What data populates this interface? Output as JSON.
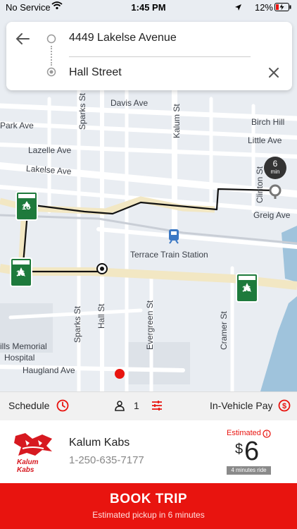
{
  "status_bar": {
    "carrier": "No Service",
    "time": "1:45 PM",
    "battery": "12%"
  },
  "route": {
    "origin": "4449 Lakelse Avenue",
    "destination": "Hall Street"
  },
  "map": {
    "streets": {
      "sparks_top": "Sparks St",
      "davis": "Davis Ave",
      "kalum": "Kalum St",
      "birch_hill": "Birch Hill",
      "park": "Park Ave",
      "little": "Little Ave",
      "lazelle": "Lazelle Ave",
      "lakelse": "Lakelse Ave",
      "clinton": "Clinton St",
      "greig": "Greig Ave",
      "sparks_bottom": "Sparks St",
      "hall": "Hall St",
      "evergreen": "Evergreen St",
      "cramer": "Cramer St",
      "haugland": "Haugland Ave"
    },
    "poi": {
      "station": "Terrace Train Station",
      "hospital_line1": "ills Memorial",
      "hospital_line2": "Hospital"
    },
    "highway_label": "16",
    "eta_badge": {
      "value": "6",
      "unit": "min"
    }
  },
  "options": {
    "schedule": "Schedule",
    "passengers": "1",
    "payment": "In-Vehicle Pay"
  },
  "cab": {
    "name": "Kalum Kabs",
    "phone": "1-250-635-7177",
    "logo_text": "Kalum Kabs",
    "estimated_label": "Estimated",
    "currency": "$",
    "price": "6",
    "ride_length": "4 minutes ride"
  },
  "book": {
    "label": "BOOK TRIP",
    "subtitle": "Estimated pickup in 6 minutes"
  },
  "colors": {
    "accent": "#e8140f",
    "map_bg": "#e9edf2",
    "road": "#ffffff",
    "highway": "#f2e7c3",
    "water": "#9fc3dc",
    "route_line": "#111111"
  }
}
